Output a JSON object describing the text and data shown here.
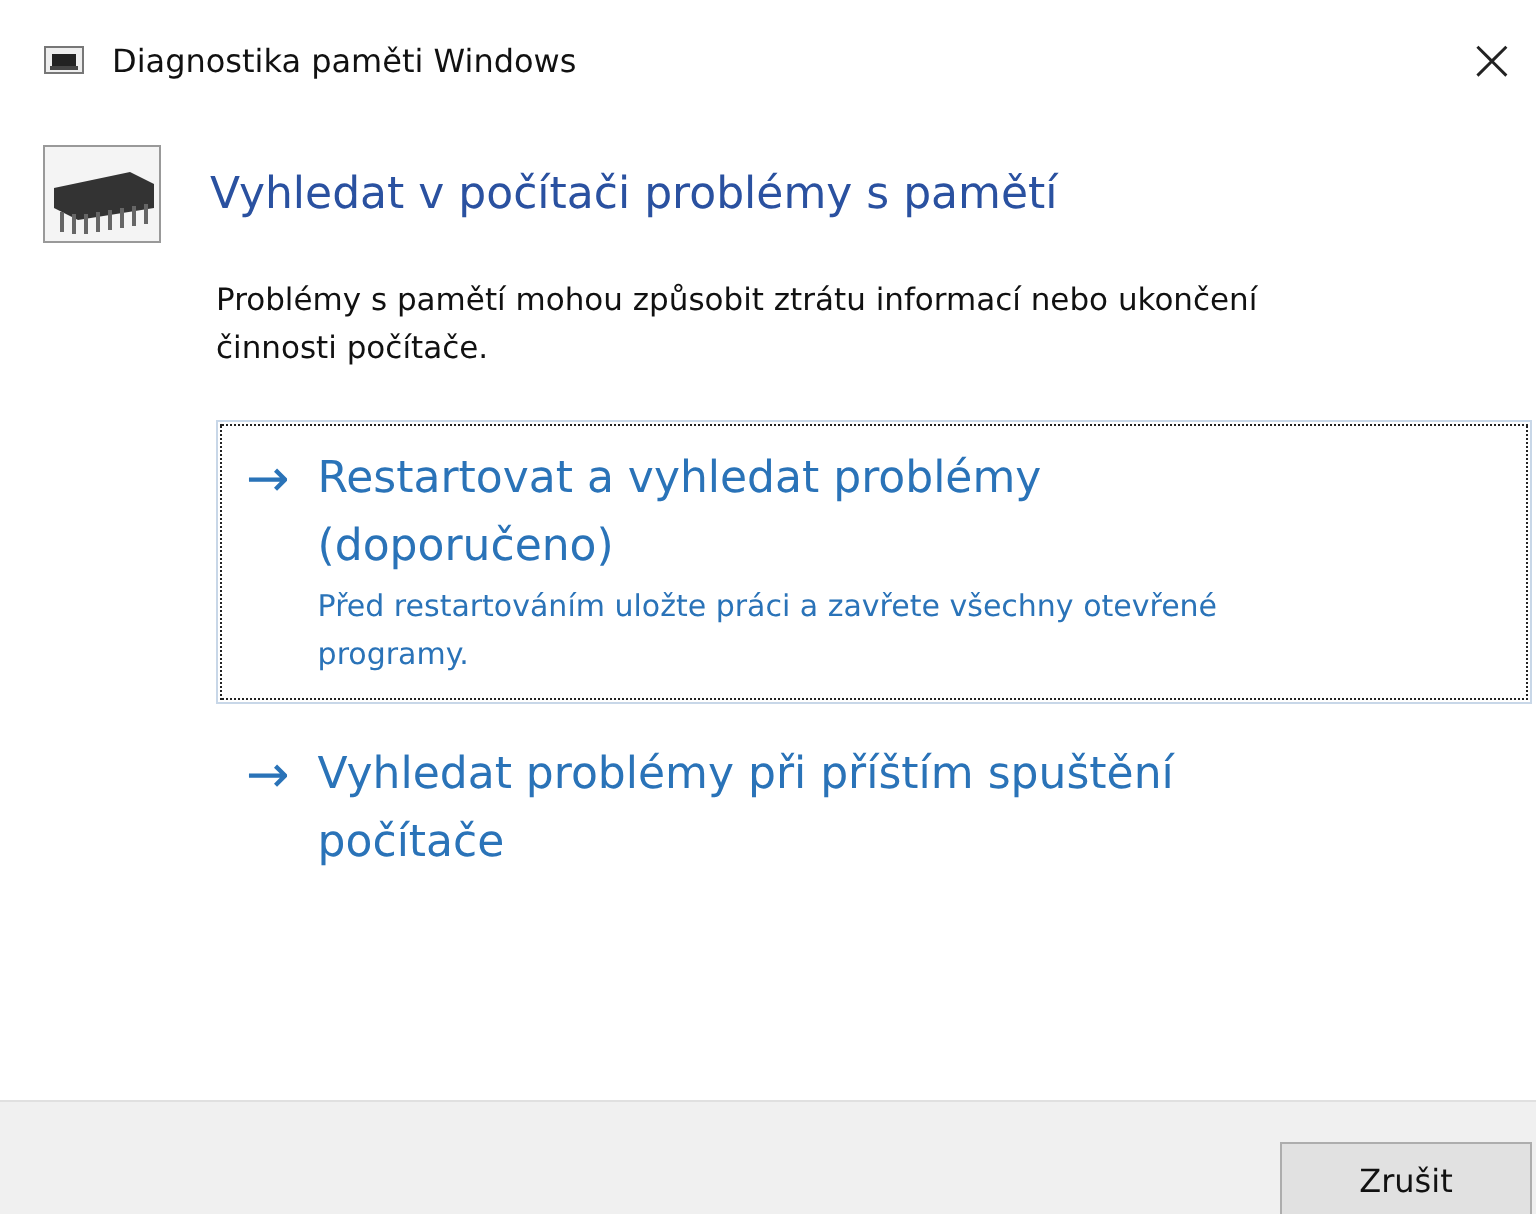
{
  "window": {
    "title": "Diagnostika paměti Windows",
    "close": "×"
  },
  "heading": "Vyhledat v počítači problémy s pamětí",
  "description": "Problémy s pamětí mohou způsobit ztrátu informací nebo ukončení činnosti počítače.",
  "options": [
    {
      "arrow": "→",
      "label": "Restartovat a vyhledat problémy (doporučeno)",
      "note": "Před restartováním uložte práci a zavřete všechny otevřené programy.",
      "selected": true
    },
    {
      "arrow": "→",
      "label": "Vyhledat problémy při příštím spuštění počítače",
      "selected": false
    }
  ],
  "buttons": [
    "Zrušit"
  ]
}
